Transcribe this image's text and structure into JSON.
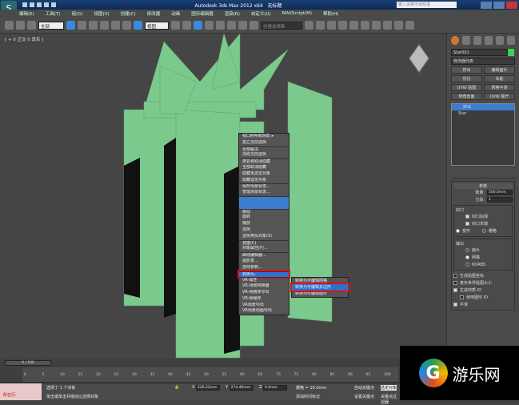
{
  "title": {
    "app": "Autodesk 3ds Max  2012 x64",
    "doc": "无标题",
    "search_placeholder": "键入关键字或短语"
  },
  "menubar": [
    "编辑(E)",
    "工具(T)",
    "组(G)",
    "视图(V)",
    "创建(C)",
    "修改器",
    "动画",
    "图形编辑器",
    "渲染(R)",
    "自定义(U)",
    "MAXScript(M)",
    "帮助(H)"
  ],
  "toolbar": {
    "filter": "全部",
    "ref_coord": "视图",
    "named_sel": "创建选择集"
  },
  "viewport": {
    "label": "[ + 0 正交 0 真实 ]",
    "object_color": "#7cc98d"
  },
  "context_menu": {
    "items": [
      "视口照明和阴影 ▸",
      "孤立当前选择",
      "全部解冻",
      "冻结当前选择",
      "按名称取消隐藏",
      "全部取消隐藏",
      "隐藏未选定对象",
      "隐藏选定对象",
      "保存场景状态...",
      "管理场景状态...",
      "",
      "",
      "移动",
      "旋转",
      "缩放",
      "选择",
      "选择类似对象(S)",
      "克隆(C)",
      "对象属性(P)...",
      "曲线编辑器...",
      "摄影表...",
      "连线参数...",
      "转换为:",
      "VR-属性",
      "VR-场景转换器",
      "VR-网格体导出",
      "VR-帧缓存",
      "VR场景导出",
      "VR场景动画导出"
    ],
    "highlighted": "转换为:",
    "submenu": [
      "转换为可编辑网格",
      "转换为可编辑多边形",
      "转换为可编辑面片"
    ],
    "submenu_highlighted": "转换为可编辑多边形"
  },
  "panel": {
    "object_name": "Star001",
    "object_color": "#3ed153",
    "modifier_list": "修改器列表",
    "buttons": [
      "挤出",
      "编辑面片",
      "优化",
      "车削",
      "UVW 贴图",
      "网格平滑",
      "倒角剖面",
      "UVW 展开"
    ],
    "stack": [
      "挤出",
      "Star"
    ],
    "params": {
      "title": "参数",
      "amount_label": "数量:",
      "amount": "500.0mm",
      "segments_label": "分段:",
      "segments": "1",
      "cap_title": "封口",
      "cap_start": "封口始端",
      "cap_end": "封口末端",
      "morph": "变形",
      "grid": "栅格",
      "output_title": "输出",
      "out_patch": "面片",
      "out_mesh": "网格",
      "out_nurbs": "NURBS",
      "gen_map": "生成贴图坐标",
      "real_world": "真实世界贴图大小",
      "gen_mat": "生成材质 ID",
      "use_shape_id": "使用图形 ID",
      "smooth": "平滑"
    }
  },
  "timeline": {
    "frame": "0 / 100",
    "ticks": [
      "0",
      "5",
      "10",
      "15",
      "20",
      "25",
      "30",
      "35",
      "40",
      "45",
      "50",
      "55",
      "60",
      "65",
      "70",
      "75",
      "80",
      "85",
      "90",
      "95",
      "100"
    ]
  },
  "status": {
    "running": "所在行:",
    "selected": "选择了 1 个对象",
    "hint": "单击或单击并拖动以选择对象",
    "x": "226.22mm",
    "y": "274.46mm",
    "z": "0.0mm",
    "grid": "栅格 = 10.0mm",
    "add_time_tag": "添加时间标记",
    "auto_key": "自动关键点",
    "set_key": "设置关键点",
    "selected_obj": "选定对象",
    "key_filter": "关键点过滤器"
  },
  "watermark": {
    "text": "游乐网",
    "letter": "G"
  }
}
